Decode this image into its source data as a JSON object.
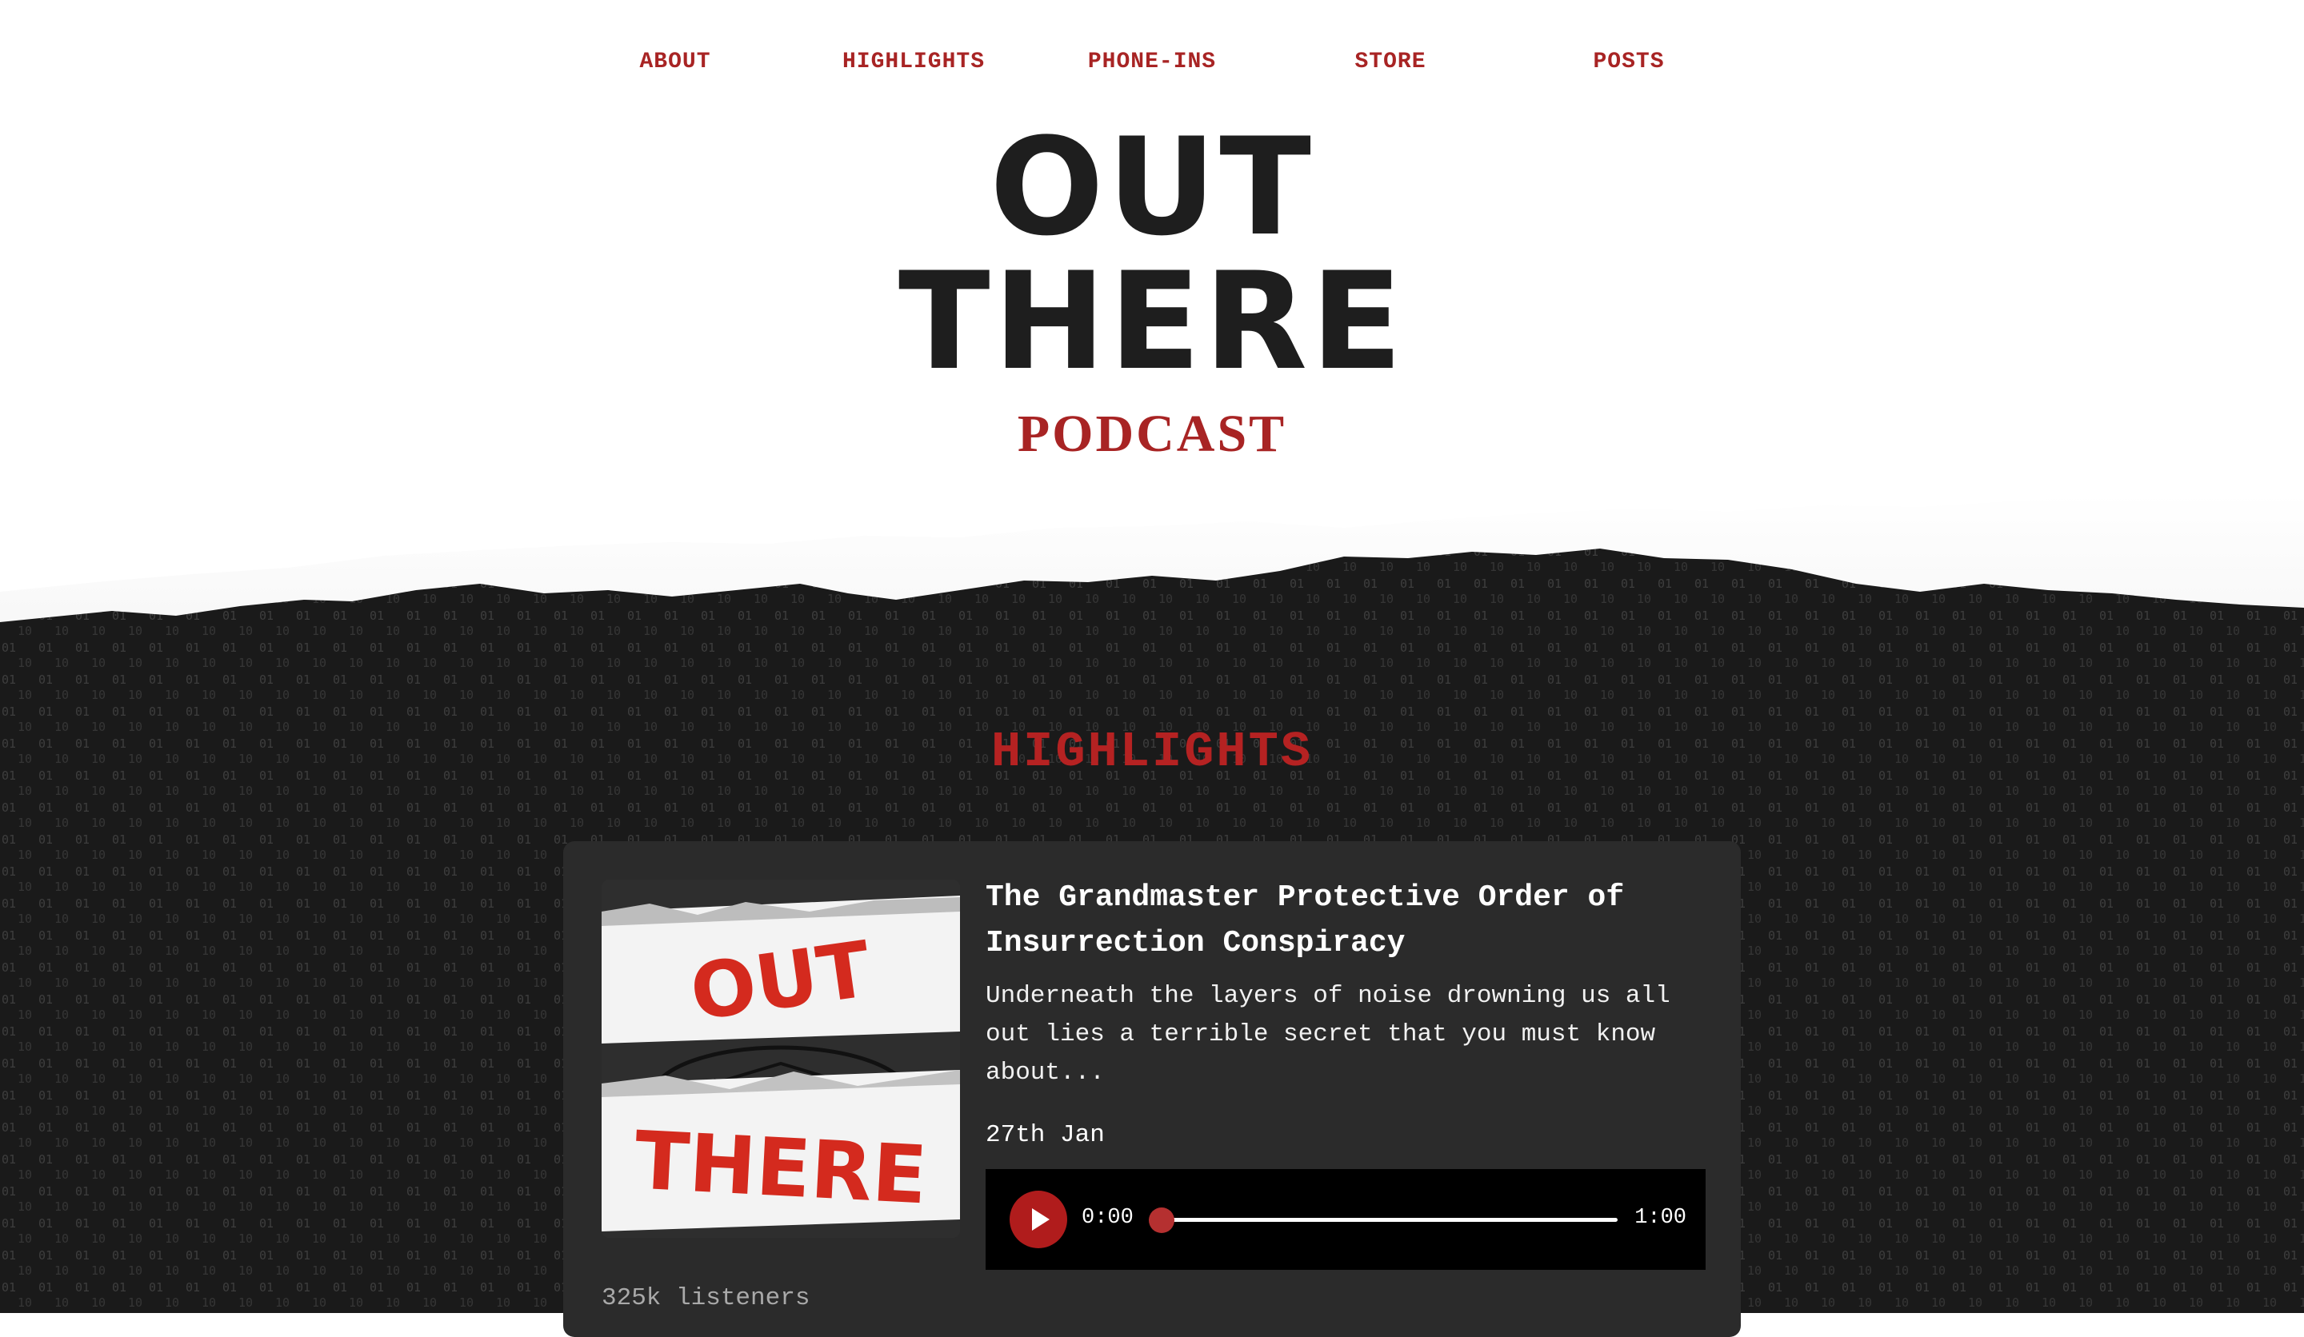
{
  "nav": {
    "items": [
      {
        "label": "ABOUT"
      },
      {
        "label": "HIGHLIGHTS"
      },
      {
        "label": "PHONE-INS"
      },
      {
        "label": "STORE"
      },
      {
        "label": "POSTS"
      }
    ]
  },
  "logo": {
    "line1": "OUT",
    "line2": "THERE",
    "subtitle": "PODCAST"
  },
  "highlights": {
    "heading": "HIGHLIGHTS",
    "episode": {
      "art_line1": "OUT",
      "art_line2": "THERE",
      "title": "The Grandmaster Protective Order of Insurrection Conspiracy",
      "description": "Underneath the layers of noise drowning us all out lies a terrible secret that you must know about...",
      "date": "27th Jan",
      "player": {
        "current_time": "0:00",
        "duration": "1:00",
        "progress": 0
      },
      "listeners": "325k listeners"
    }
  },
  "colors": {
    "accent": "#a82424",
    "dark_bg": "#1c1c1c",
    "card_bg": "#2b2b2b",
    "logo_text": "#1e1e1e"
  }
}
